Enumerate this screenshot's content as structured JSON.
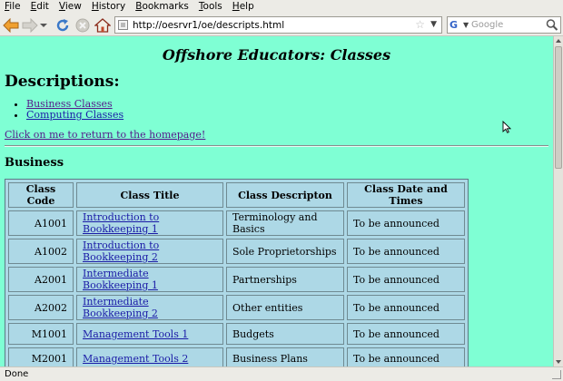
{
  "menubar": {
    "items": [
      {
        "label": "File",
        "mnemonic": "F",
        "rest": "ile"
      },
      {
        "label": "Edit",
        "mnemonic": "E",
        "rest": "dit"
      },
      {
        "label": "View",
        "mnemonic": "V",
        "rest": "iew"
      },
      {
        "label": "History",
        "mnemonic": "H",
        "rest": "istory"
      },
      {
        "label": "Bookmarks",
        "mnemonic": "B",
        "rest": "ookmarks"
      },
      {
        "label": "Tools",
        "mnemonic": "T",
        "rest": "ools"
      },
      {
        "label": "Help",
        "mnemonic": "H",
        "rest": "elp"
      }
    ]
  },
  "toolbar": {
    "url": "http://oesrvr1/oe/descripts.html",
    "search_placeholder": "Google",
    "icons": [
      "back-arrow-icon",
      "forward-arrow-icon",
      "history-dropdown-icon",
      "reload-icon",
      "stop-icon",
      "home-icon",
      "site-identity-icon",
      "bookmark-star-icon",
      "url-dropdown-icon",
      "google-search-engine-icon",
      "search-magnifier-icon"
    ]
  },
  "page": {
    "title": "Offshore Educators: Classes",
    "descriptions_heading": "Descriptions:",
    "description_links": [
      "Business Classes",
      "Computing Classes"
    ],
    "home_link": "Click on me to return to the homepage!",
    "section_heading": "Business",
    "table": {
      "headers": [
        "Class Code",
        "Class Title",
        "Class Descripton",
        "Class Date and Times"
      ],
      "rows": [
        {
          "code": "A1001",
          "title": "Introduction to Bookkeeping 1",
          "description": "Terminology and Basics",
          "date": "To be announced"
        },
        {
          "code": "A1002",
          "title": "Introduction to Bookkeeping 2",
          "description": "Sole Proprietorships",
          "date": "To be announced"
        },
        {
          "code": "A2001",
          "title": "Intermediate Bookkeeping 1",
          "description": "Partnerships",
          "date": "To be announced"
        },
        {
          "code": "A2002",
          "title": "Intermediate Bookkeeping 2",
          "description": "Other entities",
          "date": "To be announced"
        },
        {
          "code": "M1001",
          "title": "Management Tools 1",
          "description": "Budgets",
          "date": "To be announced"
        },
        {
          "code": "M2001",
          "title": "Management Tools 2",
          "description": "Business Plans",
          "date": "To be announced"
        }
      ]
    }
  },
  "statusbar": {
    "status": "Done"
  },
  "colors": {
    "page_background": "#7fffd4",
    "table_background": "#add8e6",
    "link": "#1a1aa6",
    "visited_link": "#551a8b"
  }
}
